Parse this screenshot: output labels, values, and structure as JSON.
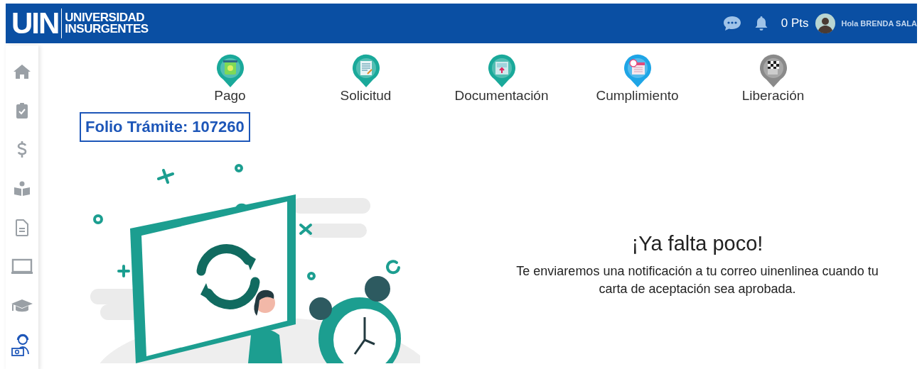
{
  "header": {
    "logo_mark": "UIN",
    "logo_line_1": "UNIVERSIDAD",
    "logo_line_2": "INSURGENTES",
    "points": "0 Pts",
    "greeting": "Hola BRENDA SALA"
  },
  "sidebar": {
    "items": [
      {
        "kind": "home",
        "selected": false
      },
      {
        "kind": "clipboard",
        "selected": false
      },
      {
        "kind": "dollar",
        "selected": false
      },
      {
        "kind": "reader",
        "selected": false
      },
      {
        "kind": "document",
        "selected": false
      },
      {
        "kind": "laptop",
        "selected": false
      },
      {
        "kind": "graduation",
        "selected": false
      },
      {
        "kind": "support",
        "selected": true
      }
    ]
  },
  "steps": [
    {
      "label": "Pago",
      "kind": "money",
      "color": "#1aa99a"
    },
    {
      "label": "Solicitud",
      "kind": "form",
      "color": "#1aa99a"
    },
    {
      "label": "Documentación",
      "kind": "upload",
      "color": "#1aa99a"
    },
    {
      "label": "Cumplimiento",
      "kind": "calendar",
      "color": "#1ea5e6"
    },
    {
      "label": "Liberación",
      "kind": "flag",
      "color": "#8a8a8a"
    }
  ],
  "folio": "Folio Trámite: 107260",
  "message": {
    "title": "¡Ya falta poco!",
    "body": "Te enviaremos una notificación a tu correo uinenlinea cuando tu carta de aceptación sea aprobada."
  }
}
